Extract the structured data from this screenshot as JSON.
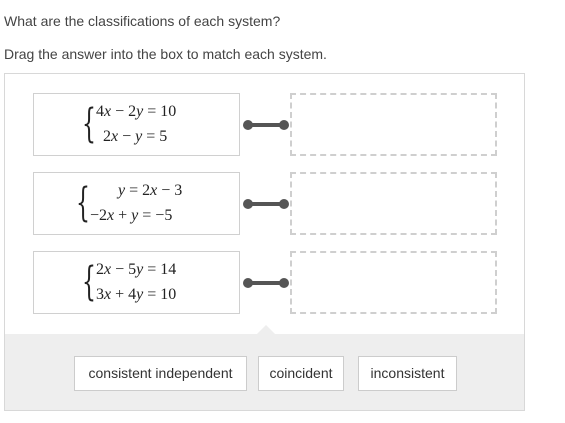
{
  "question": {
    "prompt": "What are the classifications of each system?",
    "instruction": "Drag the answer into the box to match each system."
  },
  "systems": [
    {
      "eq1": [
        "4",
        "x",
        " − 2",
        "y",
        " = 10"
      ],
      "eq2": [
        "2",
        "x",
        " − ",
        "y",
        " = 5"
      ]
    },
    {
      "eq1": [
        "",
        "y",
        " = 2",
        "x",
        " − 3"
      ],
      "eq2": [
        "−2",
        "x",
        " + ",
        "y",
        " = −5"
      ]
    },
    {
      "eq1": [
        "2",
        "x",
        " − 5",
        "y",
        " = 14"
      ],
      "eq2": [
        "3",
        "x",
        " + 4",
        "y",
        " = 10"
      ]
    }
  ],
  "answers": [
    {
      "label": "consistent independent"
    },
    {
      "label": "coincident"
    },
    {
      "label": "inconsistent"
    }
  ]
}
